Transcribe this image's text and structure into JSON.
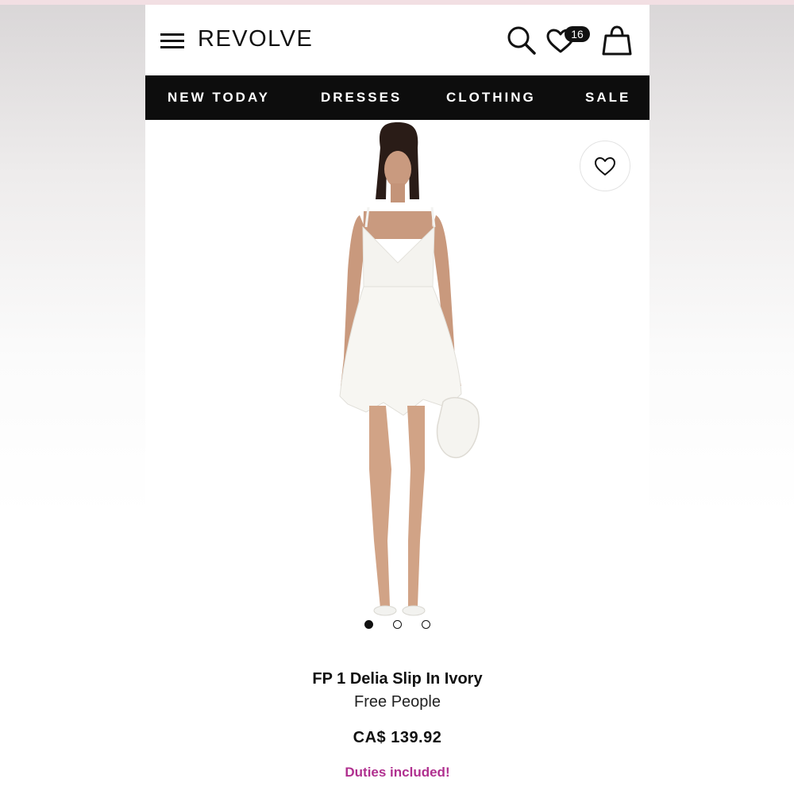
{
  "header": {
    "logo": "REVOLVE",
    "wishlist_count": "16",
    "icons": [
      "menu-icon",
      "search-icon",
      "heart-icon",
      "bag-icon"
    ]
  },
  "nav": {
    "items": [
      "NEW TODAY",
      "DRESSES",
      "CLOTHING",
      "SALE"
    ]
  },
  "gallery": {
    "image_count": 3,
    "active_index": 0
  },
  "product": {
    "title": "FP 1 Delia Slip In Ivory",
    "brand": "Free People",
    "price": "CA$ 139.92",
    "duties_note": "Duties included!"
  },
  "colors": {
    "nav_background": "#0d0d0d",
    "duties_text": "#b0308f",
    "badge_background": "#111111"
  }
}
